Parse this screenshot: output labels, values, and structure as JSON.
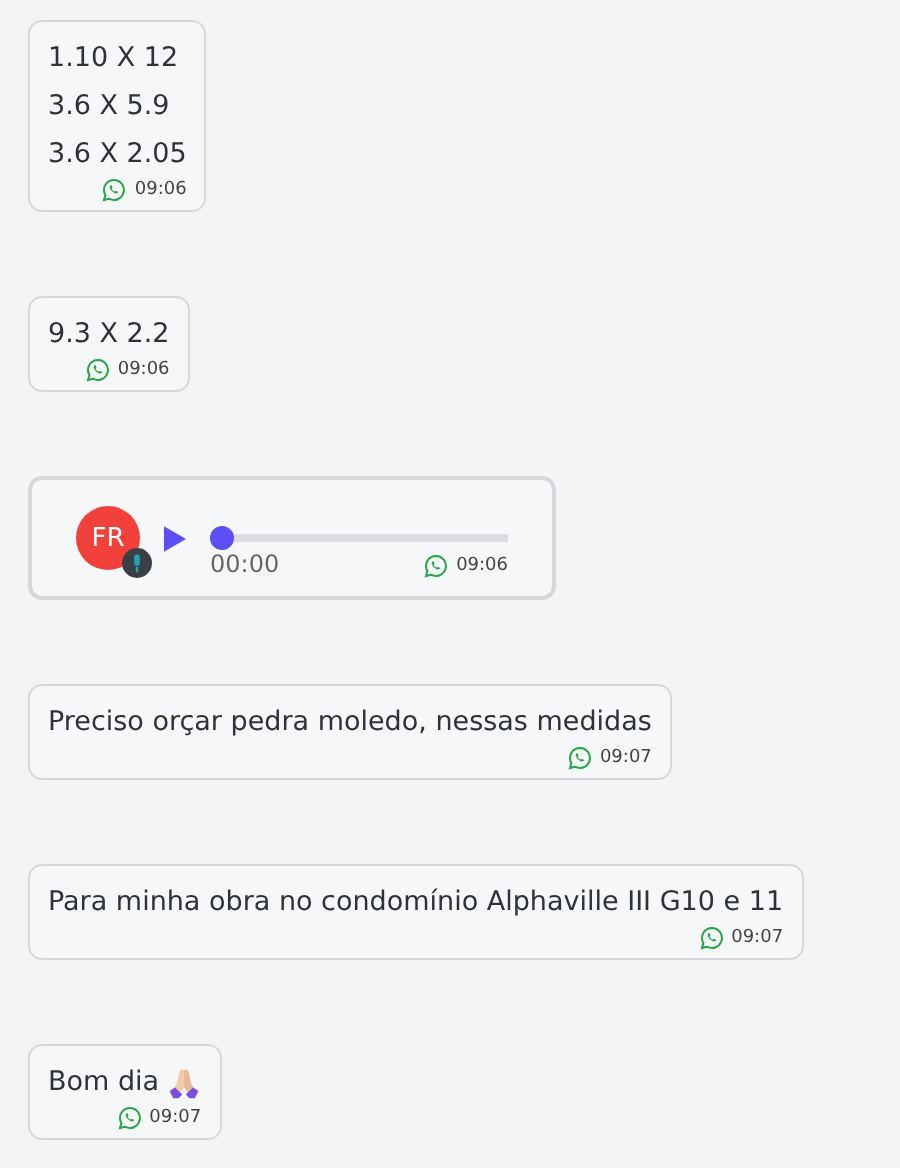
{
  "messages": [
    {
      "kind": "text",
      "lines": [
        "1.10 X 12",
        "3.6 X 5.9",
        "3.6 X 2.05"
      ],
      "time": "09:06"
    },
    {
      "kind": "text",
      "lines": [
        "9.3 X 2.2"
      ],
      "time": "09:06"
    },
    {
      "kind": "audio",
      "avatar": "FR",
      "level": 0,
      "duration": "00:00",
      "time": "09:06"
    },
    {
      "kind": "text",
      "lines": [
        "Preciso orçar pedra moledo, nessas medidas"
      ],
      "time": "09:07"
    },
    {
      "kind": "text",
      "lines": [
        "Para minha obra no condomínio Alphaville III G10 e 11"
      ],
      "time": "09:07"
    },
    {
      "kind": "text",
      "lines": [
        "Bom dia"
      ],
      "praying_hands": true,
      "time": "09:07"
    }
  ]
}
